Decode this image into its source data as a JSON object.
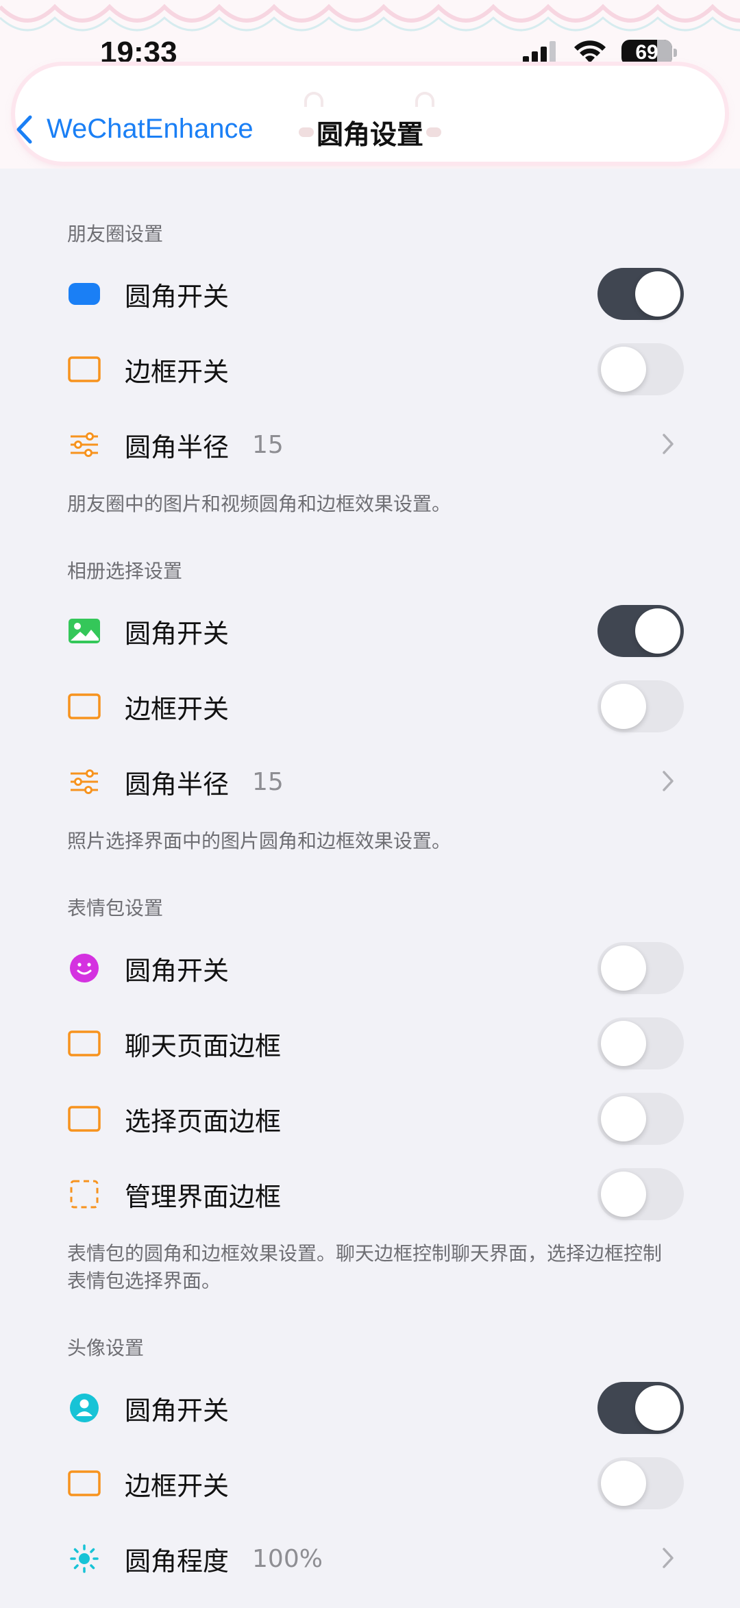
{
  "status_bar": {
    "time": "19:33",
    "battery": "69"
  },
  "nav": {
    "back_label": "WeChatEnhance",
    "title": "圆角设置"
  },
  "colors": {
    "accent": "#1a7ff5",
    "toggle_on": "#404651",
    "toggle_off": "#e5e5ea",
    "orange": "#f7931e"
  },
  "sections": [
    {
      "header": "朋友圈设置",
      "rows": [
        {
          "icon": "rounded-rect-filled-blue-icon",
          "label": "圆角开关",
          "type": "toggle",
          "on": true
        },
        {
          "icon": "border-square-icon",
          "label": "边框开关",
          "type": "toggle",
          "on": false
        },
        {
          "icon": "sliders-icon",
          "label": "圆角半径",
          "value": "15",
          "type": "link"
        }
      ],
      "footer": "朋友圈中的图片和视频圆角和边框效果设置。"
    },
    {
      "header": "相册选择设置",
      "rows": [
        {
          "icon": "photo-icon",
          "label": "圆角开关",
          "type": "toggle",
          "on": true
        },
        {
          "icon": "border-square-icon",
          "label": "边框开关",
          "type": "toggle",
          "on": false
        },
        {
          "icon": "sliders-icon",
          "label": "圆角半径",
          "value": "15",
          "type": "link"
        }
      ],
      "footer": "照片选择界面中的图片圆角和边框效果设置。"
    },
    {
      "header": "表情包设置",
      "rows": [
        {
          "icon": "smiley-icon",
          "label": "圆角开关",
          "type": "toggle",
          "on": false
        },
        {
          "icon": "border-square-icon",
          "label": "聊天页面边框",
          "type": "toggle",
          "on": false
        },
        {
          "icon": "border-square-icon",
          "label": "选择页面边框",
          "type": "toggle",
          "on": false
        },
        {
          "icon": "dashed-square-icon",
          "label": "管理界面边框",
          "type": "toggle",
          "on": false
        }
      ],
      "footer": "表情包的圆角和边框效果设置。聊天边框控制聊天界面，选择边框控制表情包选择界面。"
    },
    {
      "header": "头像设置",
      "rows": [
        {
          "icon": "person-circle-icon",
          "label": "圆角开关",
          "type": "toggle",
          "on": true
        },
        {
          "icon": "border-square-icon",
          "label": "边框开关",
          "type": "toggle",
          "on": false
        },
        {
          "icon": "sun-icon",
          "label": "圆角程度",
          "value": "100%",
          "type": "link"
        }
      ]
    }
  ]
}
